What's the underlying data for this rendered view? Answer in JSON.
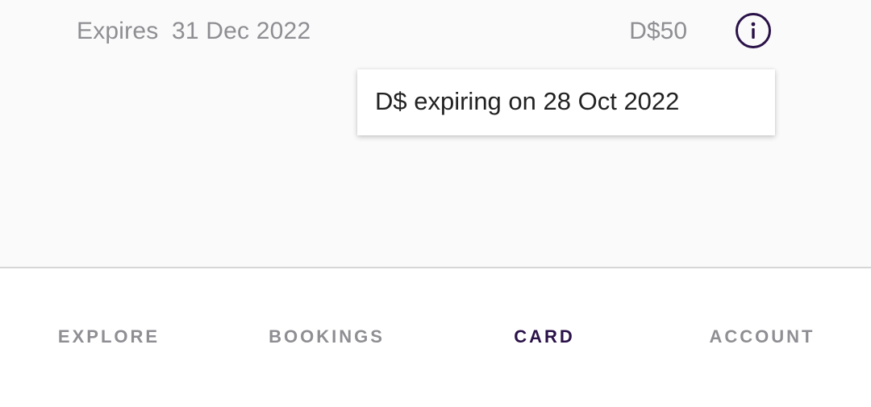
{
  "expiry_row": {
    "label": "Expires",
    "date": "31 Dec 2022",
    "amount": "D$50"
  },
  "tooltip": {
    "text": "D$ expiring on 28 Oct 2022"
  },
  "bottom_nav": {
    "items": [
      {
        "label": "EXPLORE",
        "active": false
      },
      {
        "label": "BOOKINGS",
        "active": false
      },
      {
        "label": "CARD",
        "active": true
      },
      {
        "label": "ACCOUNT",
        "active": false
      }
    ]
  },
  "colors": {
    "accent": "#2a1248",
    "muted_text": "#8e8e93",
    "content_bg": "#fafafa"
  },
  "icons": {
    "info": "info-icon"
  }
}
